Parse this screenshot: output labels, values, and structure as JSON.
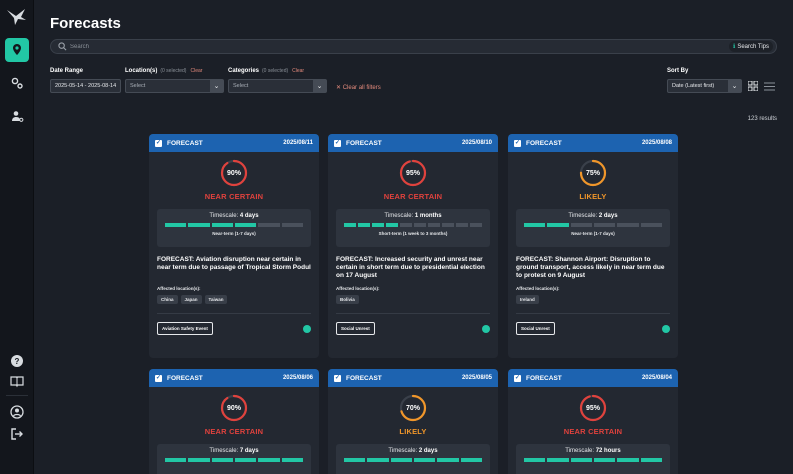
{
  "page": {
    "title": "Forecasts"
  },
  "search": {
    "placeholder": "Search",
    "tips_label": "Search Tips",
    "tips_icon": "info-icon"
  },
  "sidebar": {
    "items": [
      {
        "name": "sidebar-item-forecasts",
        "icon": "map-pin-icon",
        "active": true
      },
      {
        "name": "sidebar-item-settings",
        "icon": "gears-icon",
        "active": false
      },
      {
        "name": "sidebar-item-users",
        "icon": "user-settings-icon",
        "active": false
      }
    ],
    "bottom": [
      {
        "name": "sidebar-item-help",
        "icon": "help-icon"
      },
      {
        "name": "sidebar-item-docs",
        "icon": "book-icon"
      },
      {
        "name": "sidebar-item-profile",
        "icon": "user-circle-icon"
      },
      {
        "name": "sidebar-item-logout",
        "icon": "logout-icon"
      }
    ]
  },
  "filters": {
    "date_range": {
      "label": "Date Range",
      "value": "2025-05-14 - 2025-08-14"
    },
    "locations": {
      "label": "Location(s)",
      "count_text": "(0 selected)",
      "clear_label": "Clear",
      "placeholder": "Select"
    },
    "categories": {
      "label": "Categories",
      "count_text": "(0 selected)",
      "clear_label": "Clear",
      "placeholder": "Select"
    },
    "clear_all_label": "Clear all filters",
    "sort_by": {
      "label": "Sort By",
      "value": "Date (Latest first)"
    }
  },
  "results_text": "123 results",
  "colors": {
    "accent": "#22c7a5",
    "header_blue": "#1d63b0",
    "near_certain": "#e0423d",
    "likely": "#f0962a"
  },
  "cards": [
    {
      "label": "FORECAST",
      "date": "2025/08/11",
      "percent": "90%",
      "percent_value": 0.9,
      "likelihood": "NEAR CERTAIN",
      "likelihood_color": "#e0423d",
      "timescale_label": "Timescale:",
      "timescale_value": "4 days",
      "bars_on": 4,
      "bars_total": 6,
      "term": "Near-term (1-7 days)",
      "title": "FORECAST: Aviation disruption near certain in near term due to passage of Tropical Storm Podul",
      "affected_label": "Affected location(s):",
      "locations": [
        "China",
        "Japan",
        "Taiwan"
      ],
      "category": "Aviation Safety Event"
    },
    {
      "label": "FORECAST",
      "date": "2025/08/10",
      "percent": "95%",
      "percent_value": 0.95,
      "likelihood": "NEAR CERTAIN",
      "likelihood_color": "#e0423d",
      "timescale_label": "Timescale:",
      "timescale_value": "1 months",
      "bars_on": 4,
      "bars_total": 10,
      "term": "Short-term (1 week to 3 months)",
      "title": "FORECAST: Increased security and unrest near certain in short term due to presidential election on 17 August",
      "affected_label": "Affected location(s):",
      "locations": [
        "Bolivia"
      ],
      "category": "Social Unrest"
    },
    {
      "label": "FORECAST",
      "date": "2025/08/08",
      "percent": "75%",
      "percent_value": 0.75,
      "likelihood": "LIKELY",
      "likelihood_color": "#f0962a",
      "timescale_label": "Timescale:",
      "timescale_value": "2 days",
      "bars_on": 2,
      "bars_total": 6,
      "term": "Near-term (1-7 days)",
      "title": "FORECAST: Shannon Airport: Disruption to ground transport, access likely in near term due to protest on 9 August",
      "affected_label": "Affected location(s):",
      "locations": [
        "Ireland"
      ],
      "category": "Social Unrest"
    },
    {
      "label": "FORECAST",
      "date": "2025/08/06",
      "percent": "90%",
      "percent_value": 0.9,
      "likelihood": "NEAR CERTAIN",
      "likelihood_color": "#e0423d",
      "timescale_label": "Timescale:",
      "timescale_value": "7 days",
      "bars_on": 6,
      "bars_total": 6
    },
    {
      "label": "FORECAST",
      "date": "2025/08/05",
      "percent": "70%",
      "percent_value": 0.7,
      "likelihood": "LIKELY",
      "likelihood_color": "#f0962a",
      "timescale_label": "Timescale:",
      "timescale_value": "2 days",
      "bars_on": 6,
      "bars_total": 6
    },
    {
      "label": "FORECAST",
      "date": "2025/08/04",
      "percent": "95%",
      "percent_value": 0.95,
      "likelihood": "NEAR CERTAIN",
      "likelihood_color": "#e0423d",
      "timescale_label": "Timescale:",
      "timescale_value": "72 hours",
      "bars_on": 6,
      "bars_total": 6
    }
  ]
}
